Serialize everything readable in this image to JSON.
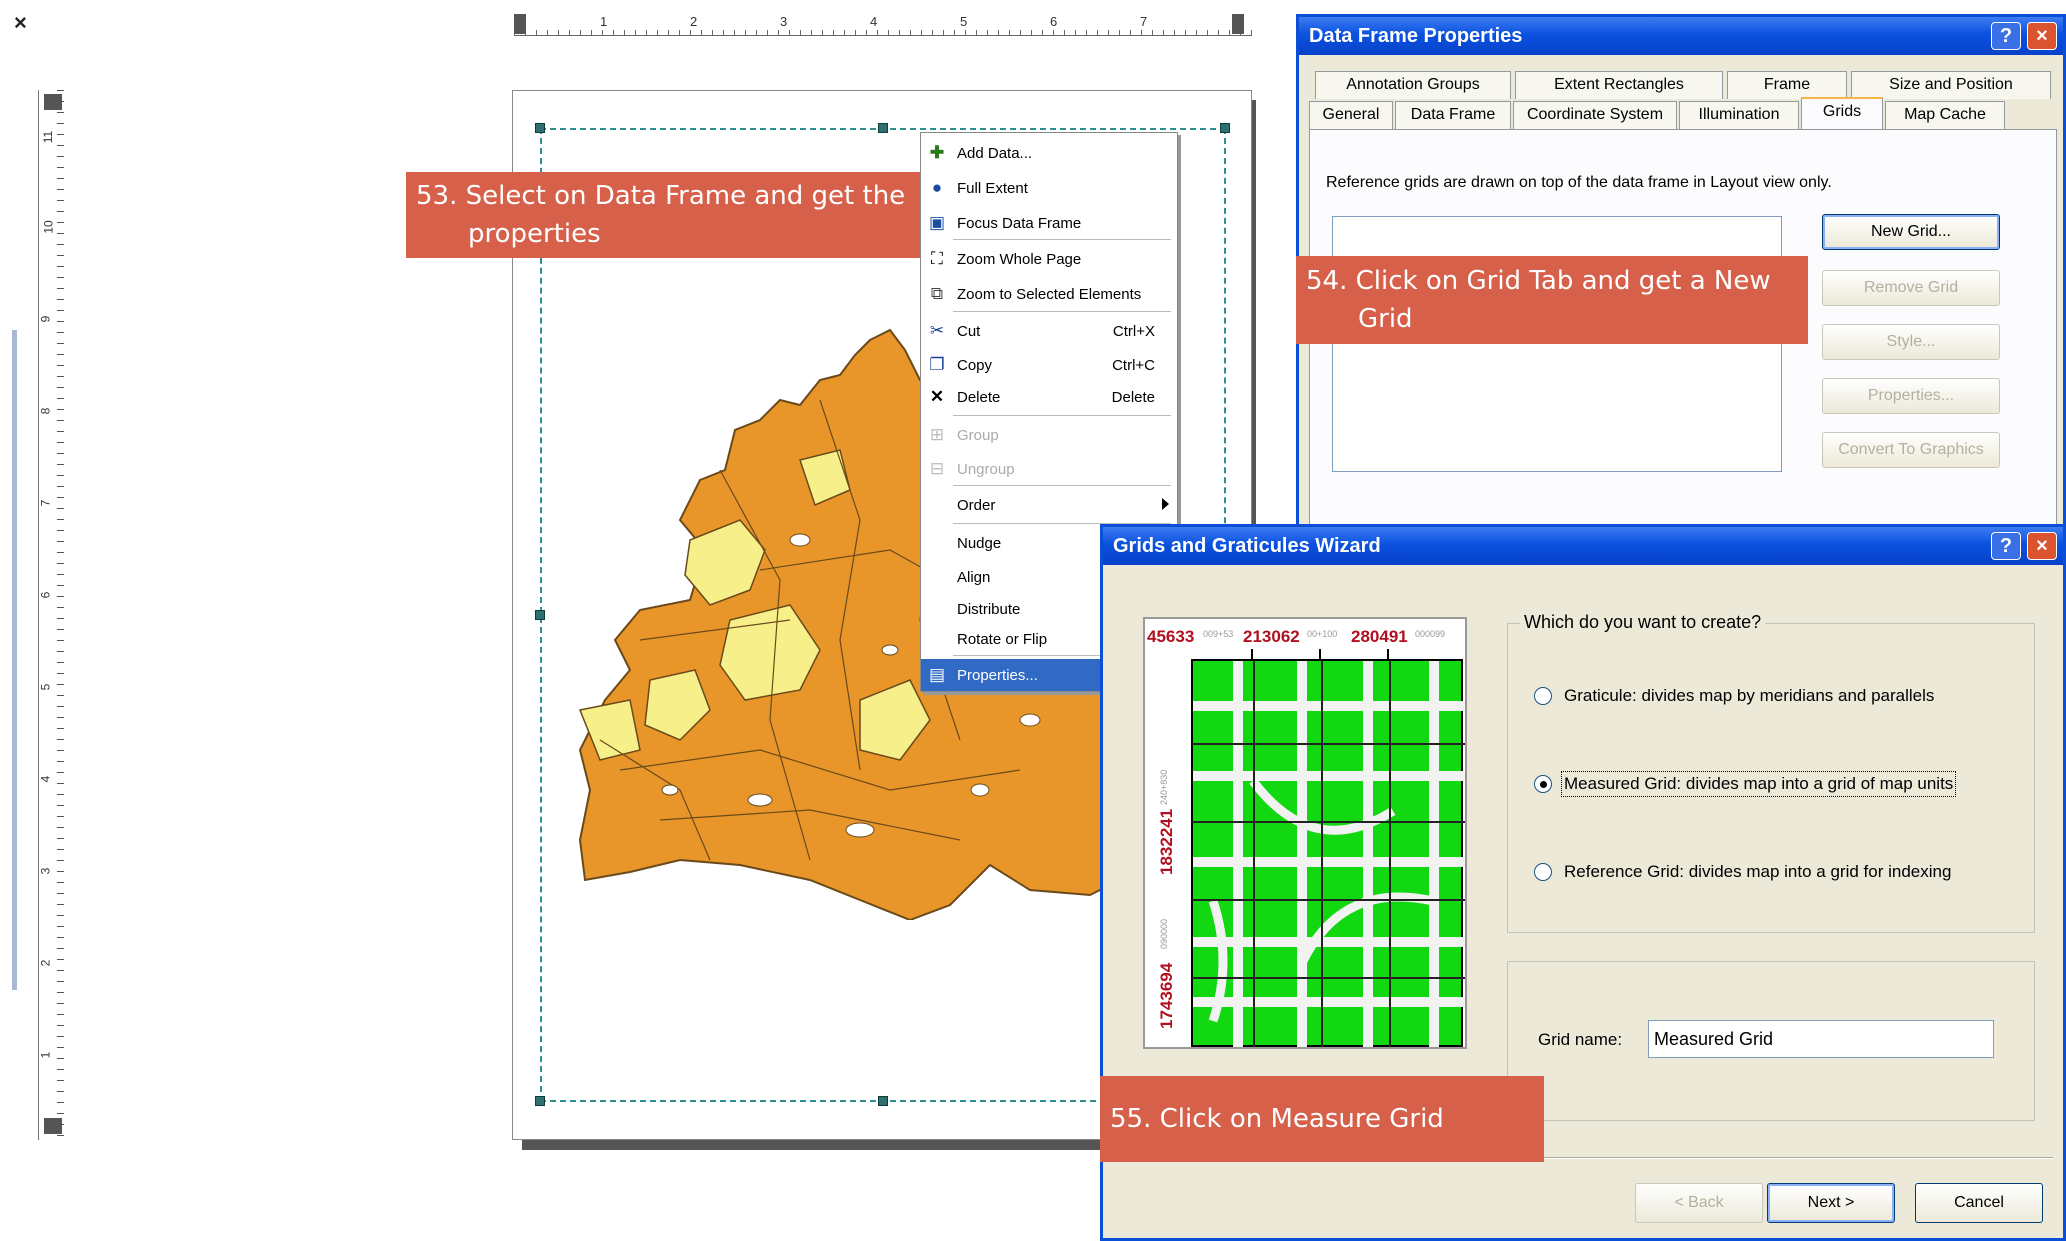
{
  "layout_view": {
    "close_label": "×",
    "horizontal_ruler": [
      "1",
      "2",
      "3",
      "4",
      "5",
      "6",
      "7"
    ],
    "vertical_ruler": [
      "11",
      "10",
      "9",
      "8",
      "7",
      "6",
      "5",
      "4",
      "3",
      "2",
      "1"
    ]
  },
  "context_menu": {
    "items": [
      {
        "label": "Add Data...",
        "shortcut": "",
        "icon": "add-data-icon",
        "state": "normal"
      },
      {
        "label": "Full Extent",
        "shortcut": "",
        "icon": "globe-icon",
        "state": "normal"
      },
      {
        "label": "Focus Data Frame",
        "shortcut": "",
        "icon": "focus-frame-icon",
        "state": "normal"
      },
      {
        "label": "Zoom Whole Page",
        "shortcut": "",
        "icon": "zoom-page-icon",
        "state": "normal"
      },
      {
        "label": "Zoom to Selected Elements",
        "shortcut": "",
        "icon": "zoom-selected-icon",
        "state": "normal"
      },
      {
        "label": "Cut",
        "shortcut": "Ctrl+X",
        "icon": "scissors-icon",
        "state": "normal"
      },
      {
        "label": "Copy",
        "shortcut": "Ctrl+C",
        "icon": "copy-icon",
        "state": "normal"
      },
      {
        "label": "Delete",
        "shortcut": "Delete",
        "icon": "delete-x-icon",
        "state": "normal"
      },
      {
        "label": "Group",
        "shortcut": "",
        "icon": "group-icon",
        "state": "disabled"
      },
      {
        "label": "Ungroup",
        "shortcut": "",
        "icon": "ungroup-icon",
        "state": "disabled"
      },
      {
        "label": "Order",
        "shortcut": "",
        "icon": "",
        "state": "normal"
      },
      {
        "label": "Nudge",
        "shortcut": "",
        "icon": "",
        "state": "normal"
      },
      {
        "label": "Align",
        "shortcut": "",
        "icon": "",
        "state": "normal"
      },
      {
        "label": "Distribute",
        "shortcut": "",
        "icon": "",
        "state": "normal"
      },
      {
        "label": "Rotate or Flip",
        "shortcut": "",
        "icon": "",
        "state": "normal"
      },
      {
        "label": "Properties...",
        "shortcut": "",
        "icon": "properties-icon",
        "state": "selected"
      }
    ]
  },
  "callouts": {
    "step53_line1": "53. Select on Data Frame and get the",
    "step53_line2": "properties",
    "step54_line1": "54. Click on Grid Tab and get a New",
    "step54_line2": "Grid",
    "step55": "55. Click on Measure Grid"
  },
  "data_frame_properties": {
    "title": "Data Frame Properties",
    "help": "?",
    "close": "×",
    "tabs_row1": [
      "Annotation Groups",
      "Extent Rectangles",
      "Frame",
      "Size and Position"
    ],
    "tabs_row2": [
      "General",
      "Data Frame",
      "Coordinate System",
      "Illumination",
      "Grids",
      "Map Cache"
    ],
    "active_tab": "Grids",
    "description": "Reference grids are drawn on top of the data frame in Layout view only.",
    "buttons": {
      "new_grid": "New Grid...",
      "remove_grid": "Remove Grid",
      "style": "Style...",
      "properties": "Properties...",
      "convert": "Convert To Graphics"
    }
  },
  "wizard": {
    "title": "Grids and Graticules Wizard",
    "help": "?",
    "close": "×",
    "preview_labels": {
      "top": [
        "45633",
        "213062",
        "280491"
      ],
      "top_small": [
        "009+53",
        "00+100",
        "000099"
      ],
      "left": [
        "1832241",
        "1743694"
      ],
      "left_small": [
        "240+830",
        "090000"
      ]
    },
    "question": "Which do you want to create?",
    "options": [
      {
        "label": "Graticule: divides map by meridians and parallels",
        "checked": false
      },
      {
        "label": "Measured Grid: divides map into a grid of map units",
        "checked": true
      },
      {
        "label": "Reference Grid: divides map into a grid for indexing",
        "checked": false
      }
    ],
    "grid_name_label": "Grid name:",
    "grid_name_value": "Measured Grid",
    "buttons": {
      "back": "< Back",
      "next": "Next >",
      "cancel": "Cancel"
    }
  },
  "colors": {
    "callout": "#d6604a",
    "map_fill": "#e8962a",
    "map_light": "#f7f08a",
    "xp_title": "#0a52e0",
    "grid_preview_green": "#11d811",
    "preview_number_red": "#b01020"
  }
}
